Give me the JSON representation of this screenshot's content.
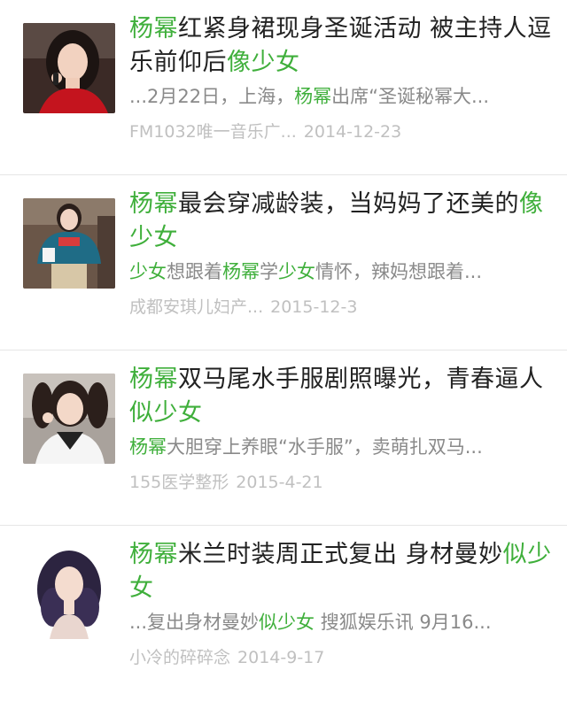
{
  "results": [
    {
      "title_parts": [
        {
          "text": "杨幂",
          "hl": true
        },
        {
          "text": "红紧身裙现身圣诞活动 被主持人逗乐前仰后",
          "hl": false
        },
        {
          "text": "像少女",
          "hl": true
        }
      ],
      "snippet_parts": [
        {
          "text": "...2月22日，上海，",
          "hl": false
        },
        {
          "text": "杨幂",
          "hl": true
        },
        {
          "text": "出席“圣诞秘幂大...",
          "hl": false
        }
      ],
      "source": "FM1032唯一音乐广...",
      "date": "2014-12-23",
      "thumb_icon": "portrait-red-dress-thumbnail"
    },
    {
      "title_parts": [
        {
          "text": "杨幂",
          "hl": true
        },
        {
          "text": "最会穿减龄装，当妈妈了还美的",
          "hl": false
        },
        {
          "text": "像少女",
          "hl": true
        }
      ],
      "snippet_parts": [
        {
          "text": "少女",
          "hl": true
        },
        {
          "text": "想跟着",
          "hl": false
        },
        {
          "text": "杨幂",
          "hl": true
        },
        {
          "text": "学",
          "hl": false
        },
        {
          "text": "少女",
          "hl": true
        },
        {
          "text": "情怀，辣妈想跟着...",
          "hl": false
        }
      ],
      "source": "成都安琪儿妇产...",
      "date": "2015-12-3",
      "thumb_icon": "portrait-sweater-thumbnail"
    },
    {
      "title_parts": [
        {
          "text": "杨幂",
          "hl": true
        },
        {
          "text": "双马尾水手服剧照曝光，青春逼人",
          "hl": false
        },
        {
          "text": "似少女",
          "hl": true
        }
      ],
      "snippet_parts": [
        {
          "text": "杨幂",
          "hl": true
        },
        {
          "text": "大胆穿上养眼“水手服”，卖萌扎双马...",
          "hl": false
        }
      ],
      "source": "155医学整形",
      "date": "2015-4-21",
      "thumb_icon": "portrait-twin-tails-thumbnail"
    },
    {
      "title_parts": [
        {
          "text": "杨幂",
          "hl": true
        },
        {
          "text": "米兰时装周正式复出 身材曼妙",
          "hl": false
        },
        {
          "text": "似少女",
          "hl": true
        }
      ],
      "snippet_parts": [
        {
          "text": "...复出身材曼妙",
          "hl": false
        },
        {
          "text": "似少女",
          "hl": true
        },
        {
          "text": " 搜狐娱乐讯 9月16...",
          "hl": false
        }
      ],
      "source": "小冷的碎碎念",
      "date": "2014-9-17",
      "thumb_icon": "portrait-curly-hair-thumbnail"
    }
  ],
  "colors": {
    "highlight": "#3faf3b",
    "title": "#222222",
    "snippet": "#8a8a8a",
    "meta": "#c0c0c0"
  }
}
